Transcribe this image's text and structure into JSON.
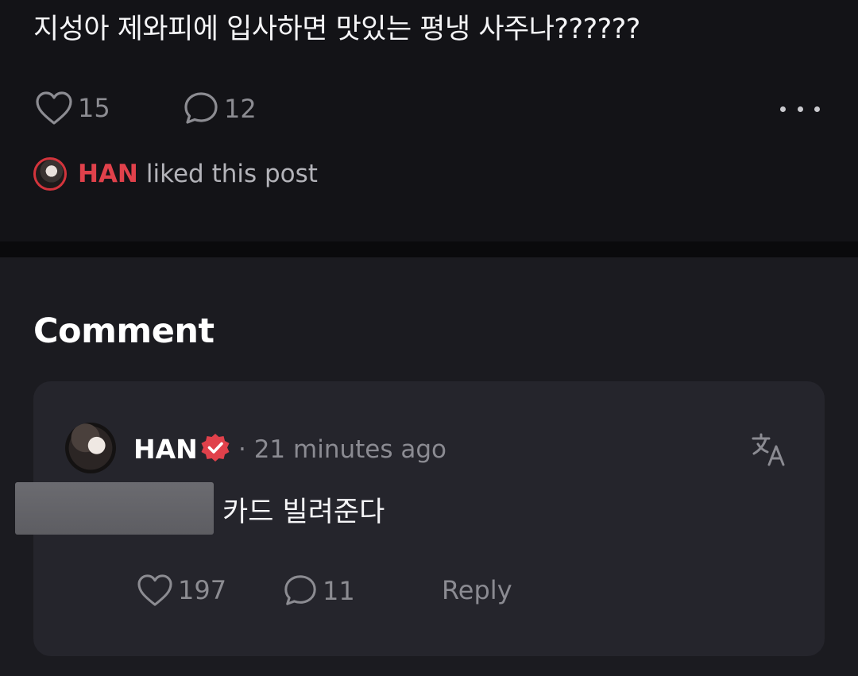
{
  "post": {
    "text": "지성아 제와피에 입사하면 맛있는 평냉 사주나??????",
    "likes": "15",
    "comments": "12",
    "liked_by_user": "HAN",
    "liked_suffix": "liked this post"
  },
  "comments_section": {
    "heading": "Comment",
    "items": [
      {
        "author": "HAN",
        "verified": true,
        "time": "· 21 minutes ago",
        "body": "카드 빌려준다",
        "likes": "197",
        "replies": "11",
        "reply_label": "Reply"
      }
    ]
  },
  "colors": {
    "background": "#131317",
    "comment_bg": "#1b1b20",
    "card_bg": "#25252c",
    "accent_red": "#e0414b",
    "muted": "#8c8c92"
  },
  "icons": [
    "heart-icon",
    "comment-bubble-icon",
    "more-dots-icon",
    "verified-badge-icon",
    "translate-icon"
  ]
}
